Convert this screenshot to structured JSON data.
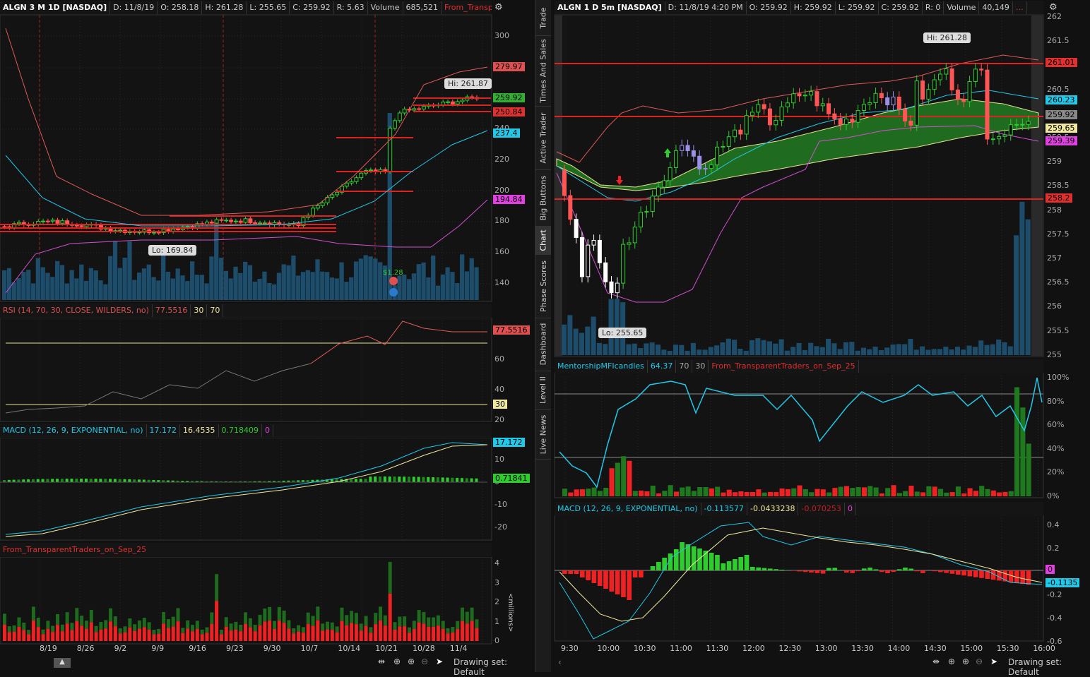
{
  "left": {
    "symbol": "ALGN 3 M 1D [NASDAQ]",
    "header": [
      "D: 11/8/19",
      "O: 258.18",
      "H: 261.28",
      "L: 255.65",
      "C: 259.92",
      "R: 5.63"
    ],
    "volume_label": "Volume",
    "volume_value": "685,521",
    "study": "From_Transparent...",
    "logo": "align",
    "hi": "Hi: 261.87",
    "lo": "Lo: 169.84",
    "earn": "$1.28",
    "price_ticks": [
      "300",
      "280",
      "260",
      "240",
      "220",
      "200",
      "180",
      "160",
      "140"
    ],
    "price_tags": [
      {
        "t": "279.97",
        "c": "#e05050"
      },
      {
        "t": "259.92",
        "c": "#30b030"
      },
      {
        "t": "250.84",
        "c": "#e03030"
      },
      {
        "t": "237.4",
        "c": "#22c8e8"
      },
      {
        "t": "194.84",
        "c": "#e040e0"
      }
    ],
    "rsi_header": "RSI (14, 70, 30, CLOSE, WILDERS, no)",
    "rsi_val": "77.5516",
    "rsi_a": "30",
    "rsi_b": "70",
    "rsi_ticks": [
      "60",
      "40",
      "20"
    ],
    "rsi_tags": [
      "77.5516",
      "30"
    ],
    "macd_header": "MACD (12, 26, 9, EXPONENTIAL, no)",
    "macd_vals": [
      "17.172",
      "16.4535",
      "0.718409",
      "0"
    ],
    "macd_ticks": [
      "10",
      "0",
      "-10",
      "-20"
    ],
    "macd_tags": [
      "17.172",
      "0.71841"
    ],
    "vol_header": "From_TransparentTraders_on_Sep_25",
    "vol_ticks": [
      "4",
      "3",
      "2",
      "1",
      "0"
    ],
    "vol_unit": "<millions>",
    "dates": [
      "8/19",
      "8/26",
      "9/2",
      "9/9",
      "9/16",
      "9/23",
      "9/30",
      "10/7",
      "10/14",
      "10/21",
      "10/28",
      "11/4"
    ],
    "drawing": "Drawing set: Default"
  },
  "right": {
    "symbol": "ALGN 1 D 5m [NASDAQ]",
    "header": [
      "D: 11/8/19 4:20 PM",
      "O: 259.92",
      "H: 259.92",
      "L: 259.92",
      "C: 259.92",
      "R: 0"
    ],
    "volume_label": "Volume",
    "volume_value": "40,149",
    "logo": "align",
    "hi": "Hi: 261.28",
    "lo": "Lo: 255.65",
    "price_ticks": [
      "262",
      "261.5",
      "261",
      "260.5",
      "260",
      "259.5",
      "259",
      "258.5",
      "258",
      "257.5",
      "257",
      "256.5",
      "256",
      "255.5",
      "255"
    ],
    "price_tags": [
      {
        "t": "261.01",
        "c": "#e03030"
      },
      {
        "t": "260.23",
        "c": "#22c8e8"
      },
      {
        "t": "259.92",
        "c": "#888"
      },
      {
        "t": "259.65",
        "c": "#f0e8a0"
      },
      {
        "t": "259.39",
        "c": "#e040e0"
      },
      {
        "t": "258.2",
        "c": "#e03030"
      }
    ],
    "mfi_header": "MentorshipMFIcandles",
    "mfi_vals": [
      "64.37",
      "70",
      "30"
    ],
    "mfi_study": "From_TransparentTraders_on_Sep_25",
    "mfi_ticks": [
      "100%",
      "80%",
      "60%",
      "40%",
      "20%",
      "0%"
    ],
    "macd_header": "MACD (12, 26, 9, EXPONENTIAL, no)",
    "macd_vals": [
      "-0.113577",
      "-0.0433238",
      "-0.070253",
      "0"
    ],
    "macd_ticks": [
      "0.4",
      "0.2",
      "0",
      "-0.2",
      "-0.4",
      "-0.6"
    ],
    "macd_tags": [
      "0",
      "-0.1135"
    ],
    "times": [
      "9:30",
      "10:00",
      "10:30",
      "11:00",
      "11:30",
      "12:00",
      "12:30",
      "13:00",
      "13:30",
      "14:00",
      "14:30",
      "15:00",
      "15:30",
      "16:00"
    ],
    "drawing": "Drawing set: Default"
  },
  "tabs": [
    "Trade",
    "Times And Sales",
    "Active Trader",
    "Big Buttons",
    "Chart",
    "Phase Scores",
    "Dashboard",
    "Level II",
    "Live News"
  ],
  "colors": {
    "up": "#2ecc2e",
    "down": "#ff3333",
    "cyan": "#22c8e8",
    "magenta": "#e040e0",
    "red_line": "#dd2222",
    "bg": "#111111"
  }
}
